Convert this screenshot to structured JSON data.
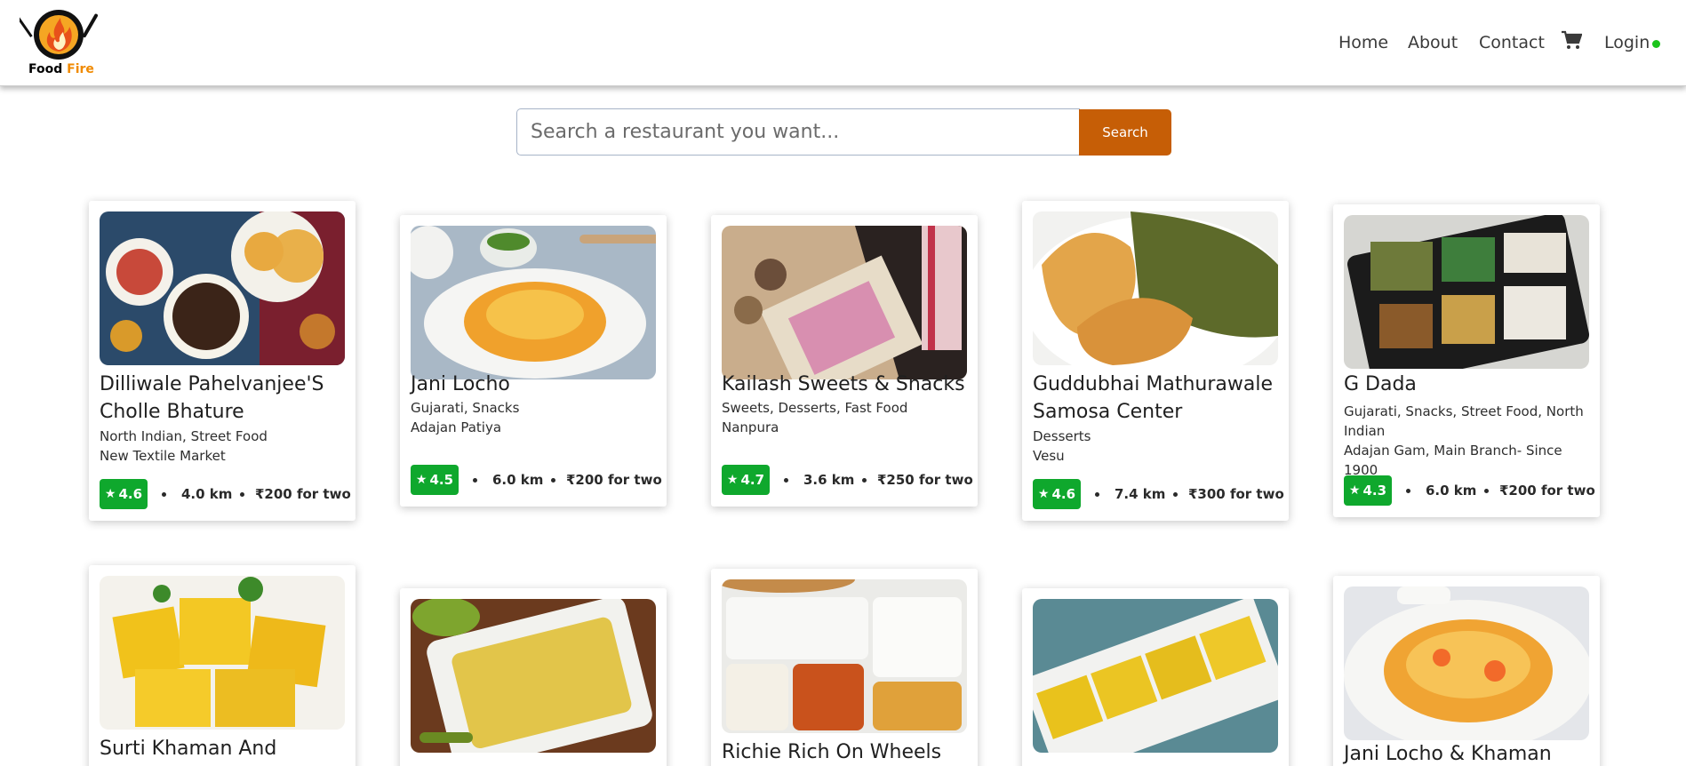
{
  "brand": {
    "line1": "Food",
    "line2": "Fire"
  },
  "nav": {
    "home": "Home",
    "about": "About",
    "contact": "Contact",
    "login": "Login"
  },
  "colors": {
    "accent": "#c65e06",
    "rating": "#0fa82d",
    "online_dot": "#1bc41b"
  },
  "icons": {
    "cart": "cart-icon",
    "star": "star-icon",
    "logo": "flame-logo-icon"
  },
  "search": {
    "placeholder": "Search a restaurant you want...",
    "button": "Search"
  },
  "restaurants": [
    {
      "name": "Dilliwale Pahelvanjee'S Cholle Bhature",
      "cuisines": "North Indian, Street Food",
      "area": "New Textile Market",
      "rating": "4.6",
      "distance": "4.0 km",
      "cost": "₹200 for two"
    },
    {
      "name": "Jani Locho",
      "cuisines": "Gujarati, Snacks",
      "area": "Adajan Patiya",
      "rating": "4.5",
      "distance": "6.0 km",
      "cost": "₹200 for two"
    },
    {
      "name": "Kailash Sweets & Snacks",
      "cuisines": "Sweets, Desserts, Fast Food",
      "area": "Nanpura",
      "rating": "4.7",
      "distance": "3.6 km",
      "cost": "₹250 for two"
    },
    {
      "name": "Guddubhai Mathurawale Samosa Center",
      "cuisines": "Desserts",
      "area": "Vesu",
      "rating": "4.6",
      "distance": "7.4 km",
      "cost": "₹300 for two"
    },
    {
      "name": "G Dada",
      "cuisines": "Gujarati, Snacks, Street Food, North Indian",
      "area": "Adajan Gam, Main Branch- Since 1900",
      "rating": "4.3",
      "distance": "6.0 km",
      "cost": "₹200 for two"
    },
    {
      "name": "Surti Khaman And Farsan"
    },
    {
      "name": ""
    },
    {
      "name": "Richie Rich On Wheels"
    },
    {
      "name": ""
    },
    {
      "name": "Jani Locho & Khaman"
    }
  ]
}
